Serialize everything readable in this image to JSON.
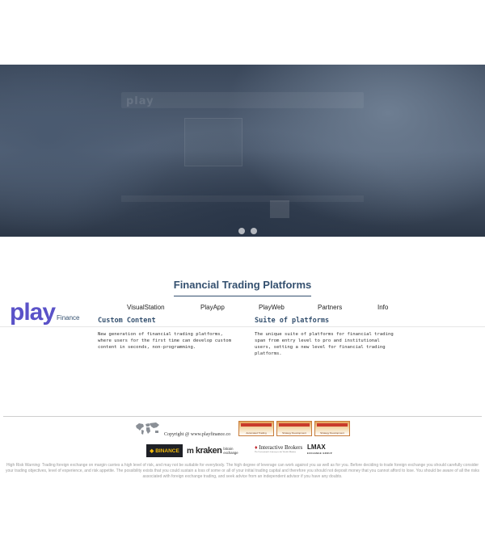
{
  "hero": {
    "blurred_logo": "play",
    "slides": [
      "slide-1",
      "slide-2"
    ]
  },
  "section": {
    "title": "Financial Trading Platforms"
  },
  "brand": {
    "play": "play",
    "finance": "Finance"
  },
  "nav": {
    "items": [
      "VisualStation",
      "PlayApp",
      "PlayWeb",
      "Partners",
      "Info"
    ]
  },
  "columns": [
    {
      "title": "Custom Content",
      "text": "New generation of financial trading platforms, where users for the first time can develop custom content in seconds, non-programming."
    },
    {
      "title": "Suite of platforms",
      "text": "The unique suite of platforms for financial trading span from entry level to pro and institutional users, setting a new level for financial trading platforms."
    }
  ],
  "footer": {
    "copyright": "Copyright @ www.playfinance.co",
    "awards": [
      "Automated Trading",
      "Strategy Development",
      "Strategy Development"
    ],
    "partners": {
      "binance": "BINANCE",
      "kraken": "kraken",
      "kraken_sub": "bitcoin exchange",
      "ib": "Interactive Brokers",
      "ib_sub": "The Professional's Gateway to the World's Markets",
      "lmax": "LMAX",
      "lmax_sub": "EXCHANGE GROUP"
    },
    "risk_warning": "High Risk Warning: Trading foreign exchange on margin carries a high level of risk, and may not be suitable for everybody. The high degree of leverage can work against you as well as for you. Before deciding to trade foreign exchange you should carefully consider your trading objectives, level of experience, and risk appetite. The possibility exists that you could sustain a loss of some or all of your initial trading capital and therefore you should not deposit money that you cannot afford to lose. You should be aware of all the risks associated with foreign exchange trading, and seek advice from an independent advisor if you have any doubts."
  },
  "colors": {
    "accent": "#5a52c8",
    "heading": "#34506f",
    "award": "#e4a45a",
    "binance": "#f0b90b"
  }
}
